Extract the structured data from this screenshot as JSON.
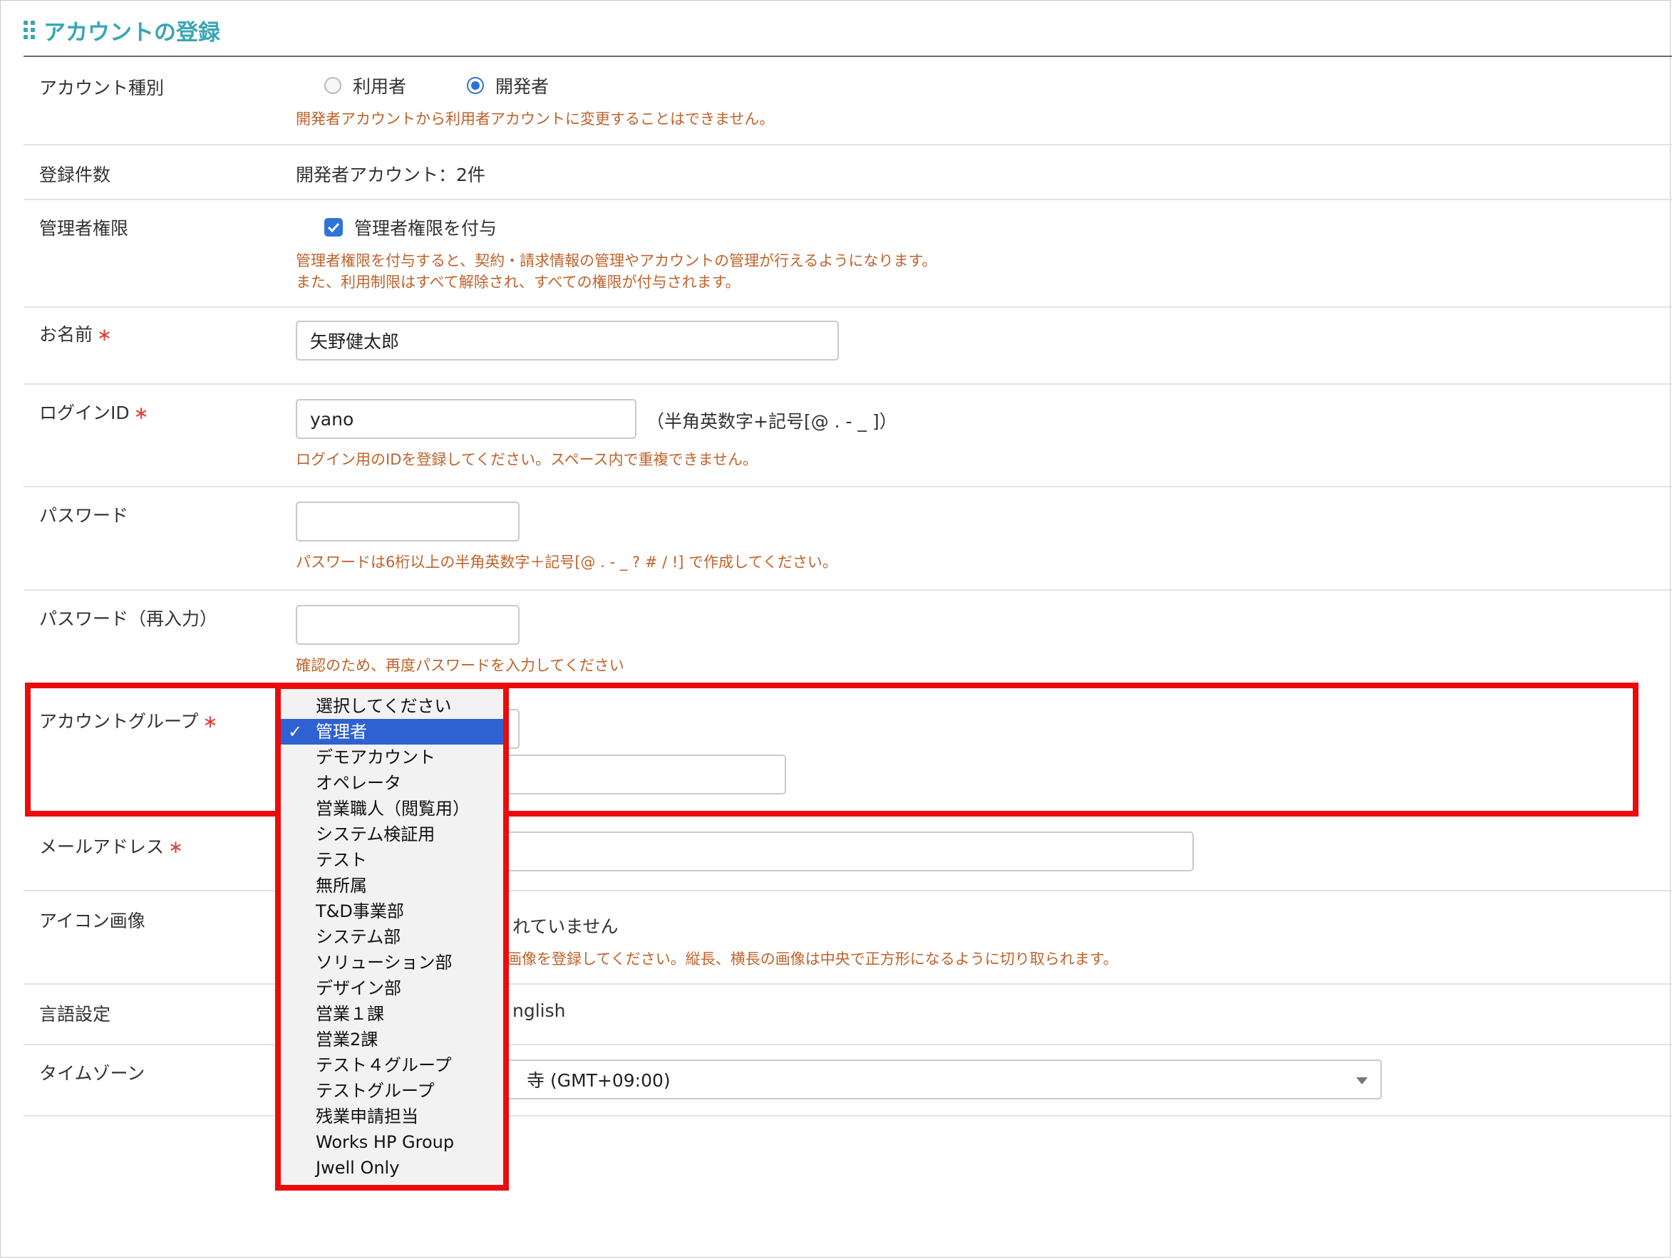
{
  "page_title": "アカウントの登録",
  "rows": {
    "account_type": {
      "label": "アカウント種別",
      "options": [
        "利用者",
        "開発者"
      ],
      "selected": "開発者",
      "note": "開発者アカウントから利用者アカウントに変更することはできません。"
    },
    "registered_count": {
      "label": "登録件数",
      "value": "開発者アカウント：2件"
    },
    "admin_privilege": {
      "label": "管理者権限",
      "checkbox_label": "管理者権限を付与",
      "checked": true,
      "note_line1": "管理者権限を付与すると、契約・請求情報の管理やアカウントの管理が行えるようになります。",
      "note_line2": "また、利用制限はすべて解除され、すべての権限が付与されます。"
    },
    "name": {
      "label": "お名前",
      "required_mark": "∗",
      "value": "矢野健太郎"
    },
    "login_id": {
      "label": "ログインID",
      "required_mark": "∗",
      "value": "yano",
      "hint": "（半角英数字+記号[@ . - _ ]）",
      "note": "ログイン用のIDを登録してください。スペース内で重複できません。"
    },
    "password": {
      "label": "パスワード",
      "value": "",
      "note": "パスワードは6桁以上の半角英数字＋記号[@ . - _ ? # / !] で作成してください。"
    },
    "password_confirm": {
      "label": "パスワード（再入力）",
      "value": "",
      "note": "確認のため、再度パスワードを入力してください"
    },
    "account_group": {
      "label": "アカウントグループ",
      "required_mark": "∗",
      "selected": "管理者",
      "options": [
        "選択してください",
        "管理者",
        "デモアカウント",
        "オペレータ",
        "営業職人（閲覧用）",
        "システム検証用",
        "テスト",
        "無所属",
        "T&D事業部",
        "システム部",
        "ソリューション部",
        "デザイン部",
        "営業１課",
        "営業2課",
        "テスト４グループ",
        "テストグループ",
        "残業申請担当",
        "Works HP Group",
        "Jwell Only"
      ],
      "check_mark": "✓"
    },
    "email": {
      "label": "メールアドレス",
      "required_mark": "∗"
    },
    "icon_image": {
      "label": "アイコン画像",
      "status_visible": "れていません",
      "note_visible": "画像を登録してください。縦長、横長の画像は中央で正方形になるように切り取られます。"
    },
    "language": {
      "label": "言語設定",
      "value_visible": "nglish"
    },
    "timezone": {
      "label": "タイムゾーン",
      "value_visible": "寺 (GMT+09:00)"
    }
  },
  "colors": {
    "accent": "#3aa6b4",
    "note": "#c0622b",
    "required": "#e0413c",
    "highlight": "#ea0c0c",
    "selection": "#2e61d1"
  }
}
